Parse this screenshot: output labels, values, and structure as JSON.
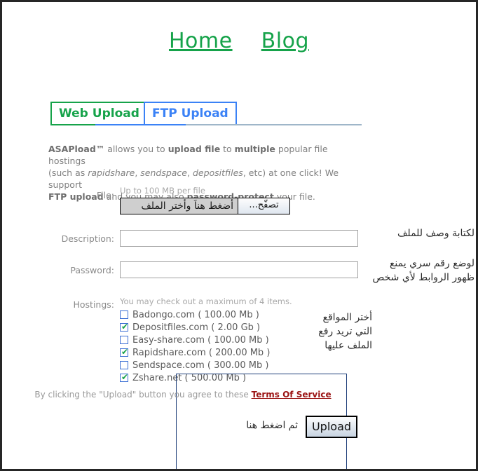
{
  "nav": {
    "home": "Home",
    "blog": "Blog"
  },
  "tabs": [
    {
      "label": "Web Upload",
      "active": true,
      "color": "#16a34a"
    },
    {
      "label": "FTP Upload",
      "active": false,
      "color": "#3b82f6"
    }
  ],
  "intro": {
    "line1_brand": "ASAPload™",
    "line1_a": " allows you to ",
    "line1_b": "upload file",
    "line1_c": " to ",
    "line1_d": "multiple",
    "line1_e": " popular file hostings",
    "line2_a": "(such as ",
    "line2_i1": "rapidshare",
    "line2_b": ", ",
    "line2_i2": "sendspace",
    "line2_c": ", ",
    "line2_i3": "depositfiles",
    "line2_d": ", etc) at one click! We support",
    "line3_a": "FTP upload",
    "line3_b": " and you may also ",
    "line3_c": "password-protect",
    "line3_d": " your file."
  },
  "form": {
    "file": {
      "label": "File:",
      "hint": "Up to 100 MB per file",
      "value": "أضغط هناَ وأختر الملف",
      "browse_label": "تصفّح..."
    },
    "description": {
      "label": "Description:",
      "value": "",
      "placeholder": ""
    },
    "password": {
      "label": "Password:",
      "value": "",
      "placeholder": ""
    },
    "hostings": {
      "label": "Hostings:",
      "hint": "You may check out a maximum of 4 items.",
      "items": [
        {
          "name": "Badongo.com ( 100.00 Mb )",
          "checked": false
        },
        {
          "name": "Depositfiles.com ( 2.00 Gb )",
          "checked": true
        },
        {
          "name": "Easy-share.com ( 100.00 Mb )",
          "checked": false
        },
        {
          "name": "Rapidshare.com ( 200.00 Mb )",
          "checked": true
        },
        {
          "name": "Sendspace.com ( 300.00 Mb )",
          "checked": false
        },
        {
          "name": "Zshare.net ( 500.00 Mb )",
          "checked": true
        }
      ]
    }
  },
  "annotations": {
    "description": "لكتابة وصف للملف",
    "password_line1": "لوضع رقم سري يمنع",
    "password_line2": "ظهور الروابط لأي شخص",
    "hostings_line1": "أختر المواقع",
    "hostings_line2": "التي تريد رفع",
    "hostings_line3": "الملف عليها",
    "upload": "ثم اضغط هنا"
  },
  "terms": {
    "prefix": "By clicking the \"Upload\" button you agree to these ",
    "link": "Terms Of Service"
  },
  "upload_button": {
    "label": "Upload"
  },
  "colors": {
    "green": "#16a34a",
    "blue": "#3b82f6",
    "link_red": "#9b1414",
    "navy_frame": "#1f3f7a",
    "page_border": "#262626"
  }
}
